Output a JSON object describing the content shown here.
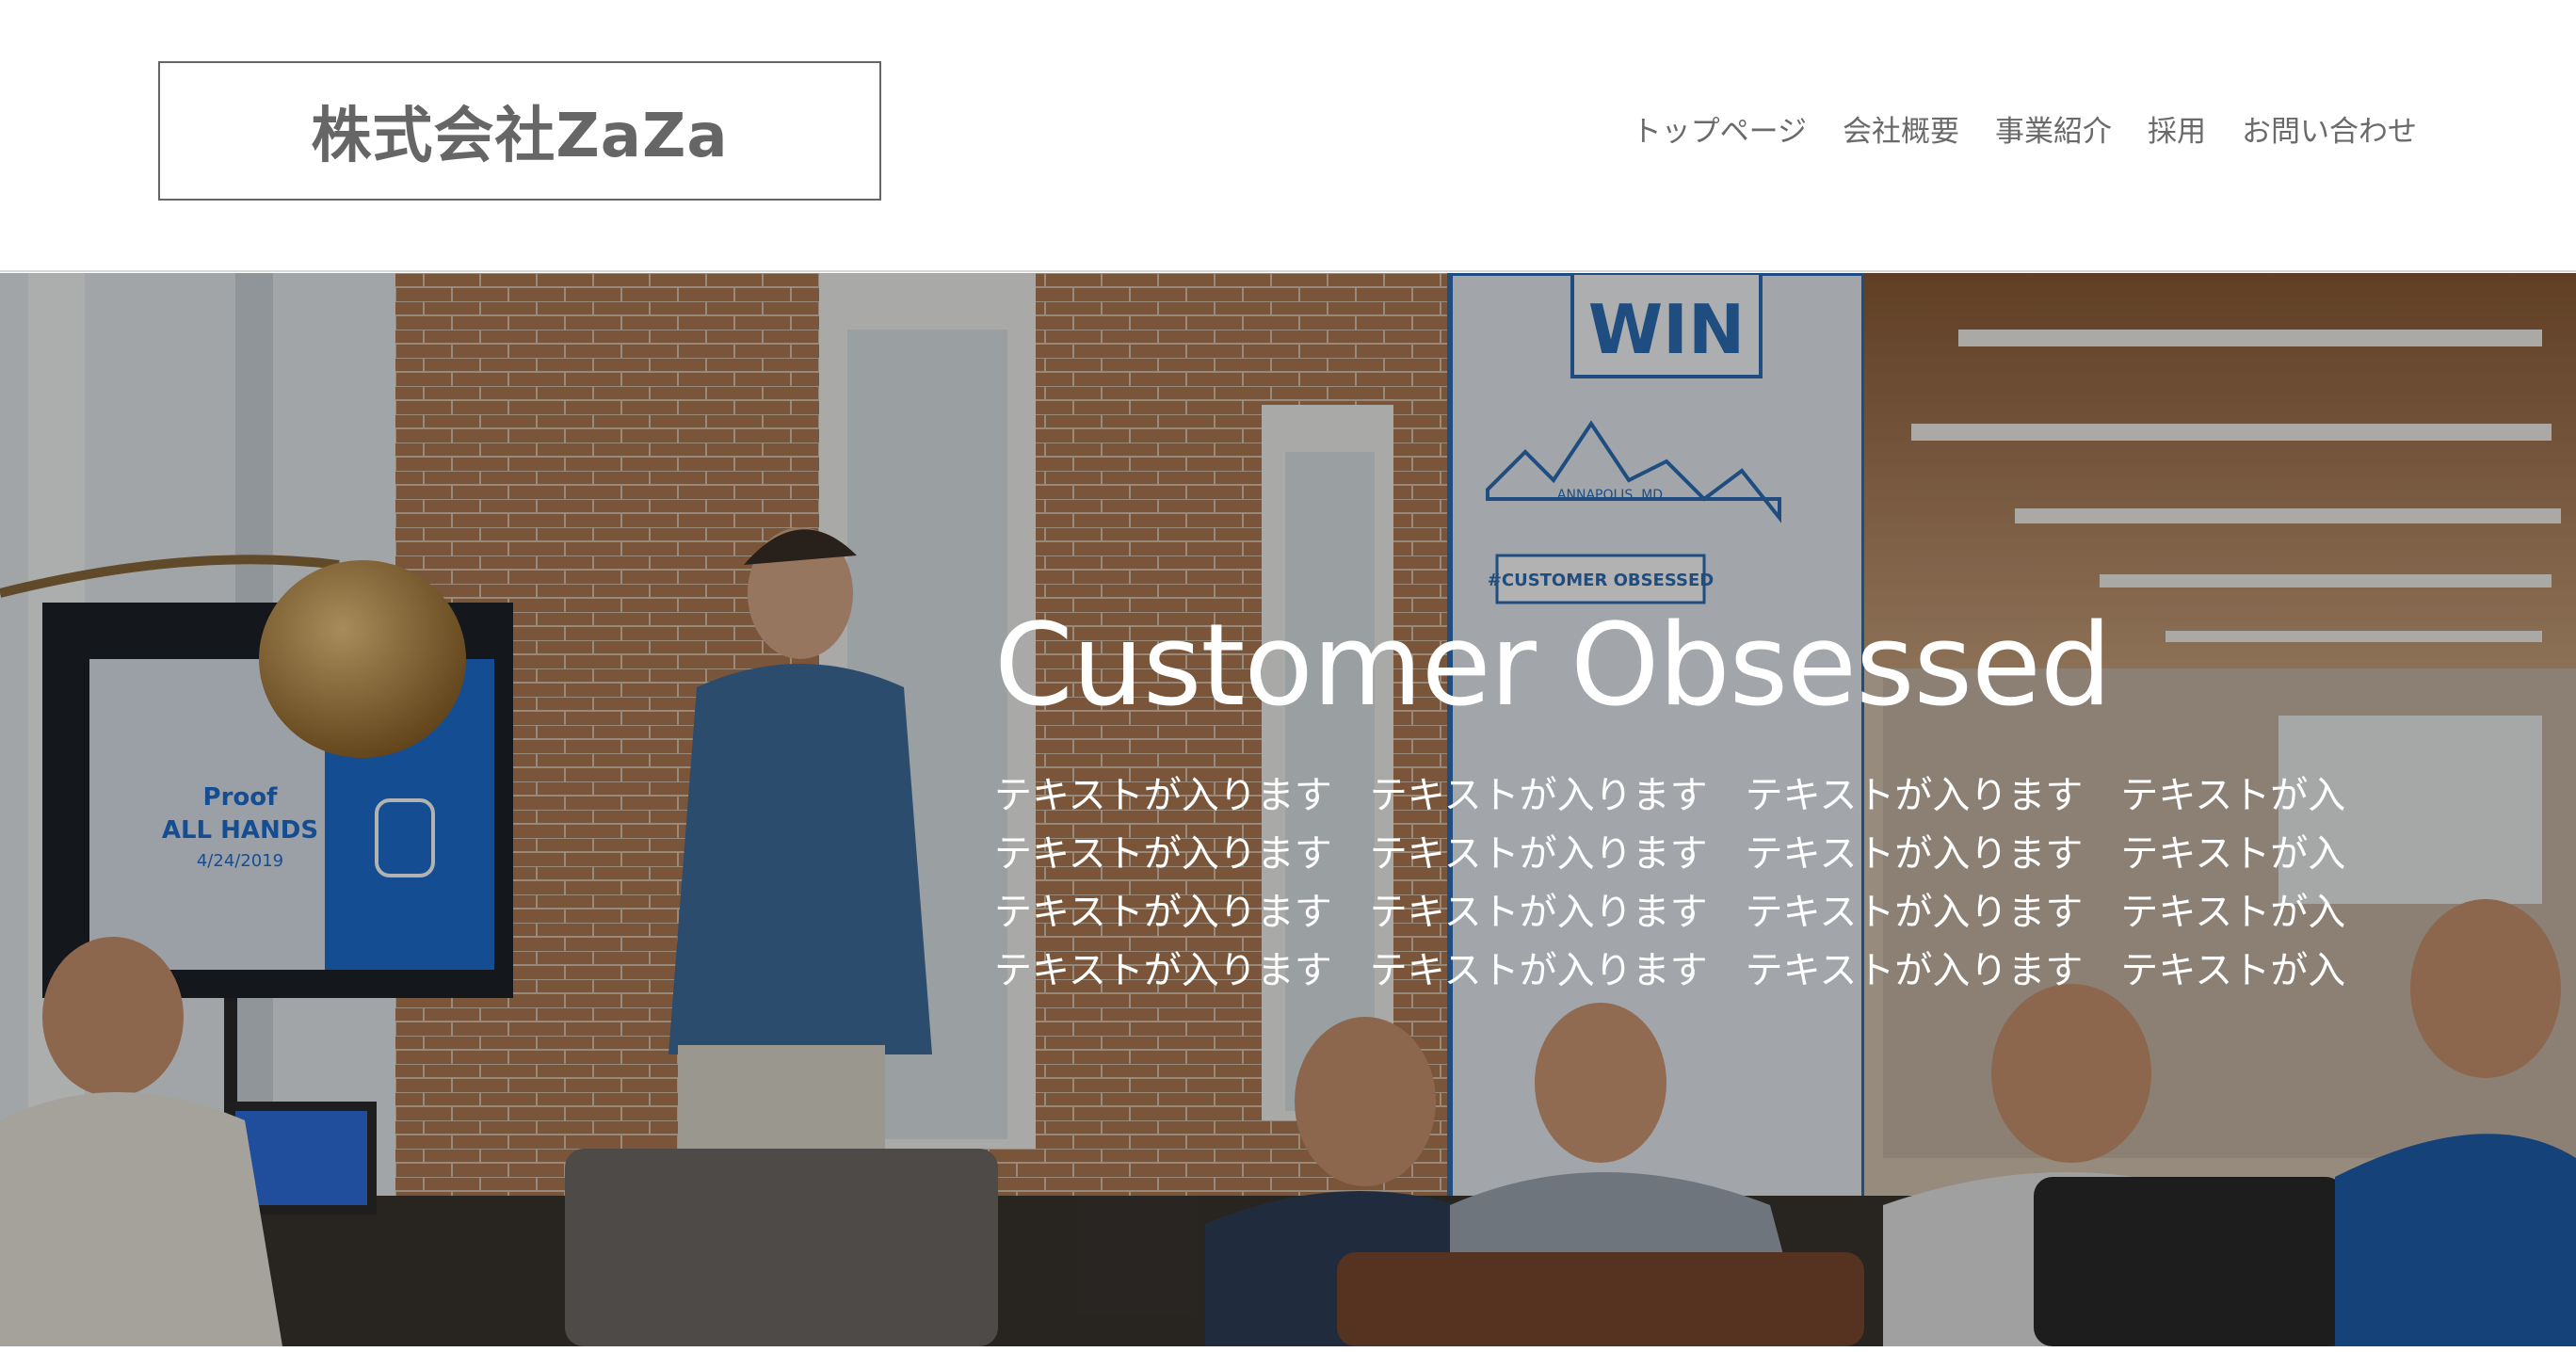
{
  "header": {
    "logo": "株式会社ZaZa",
    "nav": [
      "トップページ",
      "会社概要",
      "事業紹介",
      "採用",
      "お問い合わせ"
    ]
  },
  "hero": {
    "title": "Customer Obsessed",
    "lines": [
      "テキストが入ります　テキストが入ります　テキストが入ります　テキストが入",
      "テキストが入ります　テキストが入ります　テキストが入ります　テキストが入",
      "テキストが入ります　テキストが入ります　テキストが入ります　テキストが入",
      "テキストが入ります　テキストが入ります　テキストが入ります　テキストが入"
    ],
    "photo_texts": {
      "win_sign": "WIN",
      "city_label": "ANNAPOLIS, MD",
      "banner": "#CUSTOMER OBSESSED",
      "screen_title": "Proof",
      "screen_subtitle": "ALL HANDS",
      "screen_date": "4/24/2019"
    }
  },
  "colors": {
    "logo": "#666666",
    "nav": "#6a6a6a",
    "brick": "#b07a52",
    "screen_blue": "#1f6fd1",
    "hero_text": "#ffffff"
  }
}
